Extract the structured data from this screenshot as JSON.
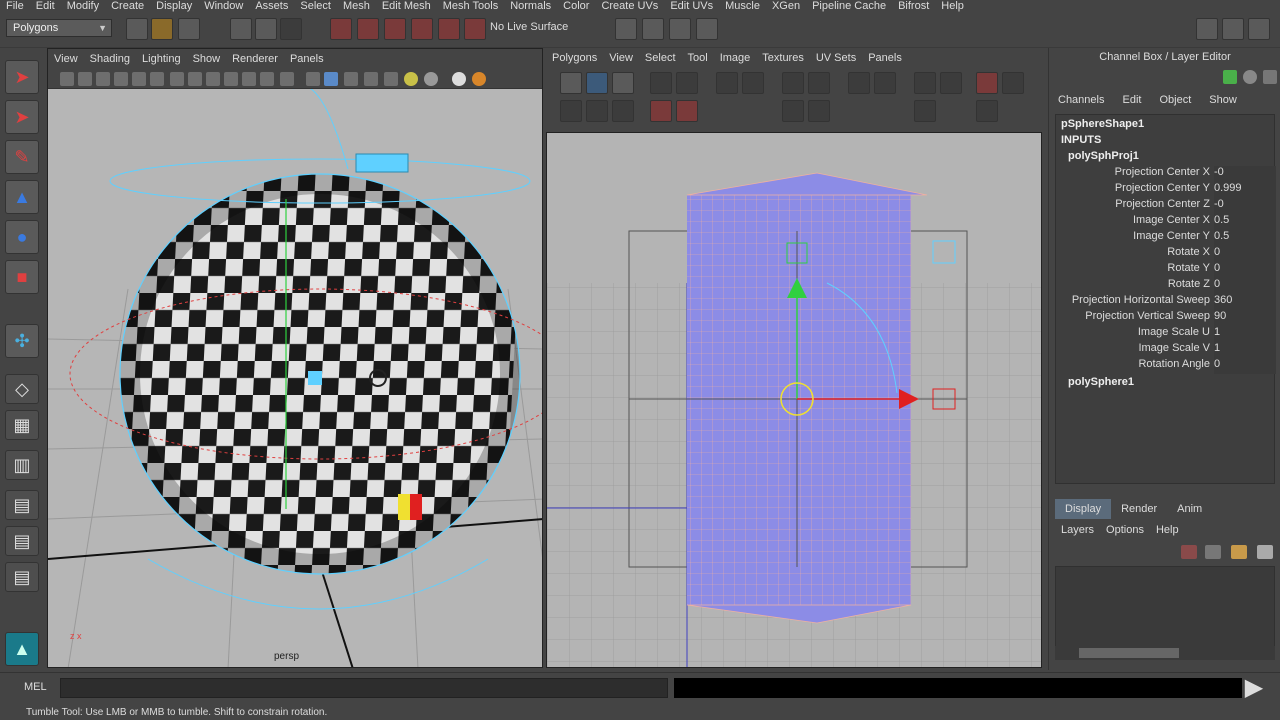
{
  "menubar": {
    "items": [
      "File",
      "Edit",
      "Modify",
      "Create",
      "Display",
      "Window",
      "Assets",
      "Select",
      "Mesh",
      "Edit Mesh",
      "Mesh Tools",
      "Normals",
      "Color",
      "Create UVs",
      "Edit UVs",
      "Muscle",
      "XGen",
      "Pipeline Cache",
      "Bifrost",
      "Help"
    ]
  },
  "shelf": {
    "mode": "Polygons",
    "live_surface": "No Live Surface"
  },
  "viewport_left": {
    "menu": [
      "View",
      "Shading",
      "Lighting",
      "Show",
      "Renderer",
      "Panels"
    ],
    "camera_label": "persp"
  },
  "uv_editor": {
    "menu": [
      "Polygons",
      "View",
      "Select",
      "Tool",
      "Image",
      "Textures",
      "UV Sets",
      "Panels"
    ]
  },
  "channel_box": {
    "title": "Channel Box / Layer Editor",
    "menu": [
      "Channels",
      "Edit",
      "Object",
      "Show"
    ],
    "shape": "pSphereShape1",
    "inputs_label": "INPUTS",
    "node": "polySphProj1",
    "attributes": [
      {
        "name": "Projection Center X",
        "value": "-0"
      },
      {
        "name": "Projection Center Y",
        "value": "0.999"
      },
      {
        "name": "Projection Center Z",
        "value": "-0"
      },
      {
        "name": "Image Center X",
        "value": "0.5"
      },
      {
        "name": "Image Center Y",
        "value": "0.5"
      },
      {
        "name": "Rotate X",
        "value": "0"
      },
      {
        "name": "Rotate Y",
        "value": "0"
      },
      {
        "name": "Rotate Z",
        "value": "0"
      },
      {
        "name": "Projection Horizontal Sweep",
        "value": "360"
      },
      {
        "name": "Projection Vertical Sweep",
        "value": "90"
      },
      {
        "name": "Image Scale U",
        "value": "1"
      },
      {
        "name": "Image Scale V",
        "value": "1"
      },
      {
        "name": "Rotation Angle",
        "value": "0"
      }
    ],
    "node2": "polySphere1"
  },
  "layer_editor": {
    "tabs": [
      "Display",
      "Render",
      "Anim"
    ],
    "menu": [
      "Layers",
      "Options",
      "Help"
    ]
  },
  "command_line": {
    "label": "MEL"
  },
  "help_line": {
    "text": "Tumble Tool: Use LMB or MMB to tumble. Shift to constrain rotation."
  },
  "colors": {
    "accent_blue": "#5b6b7b",
    "uv_fill": "#8c8ce6",
    "selection_cyan": "#5fd0ff"
  }
}
